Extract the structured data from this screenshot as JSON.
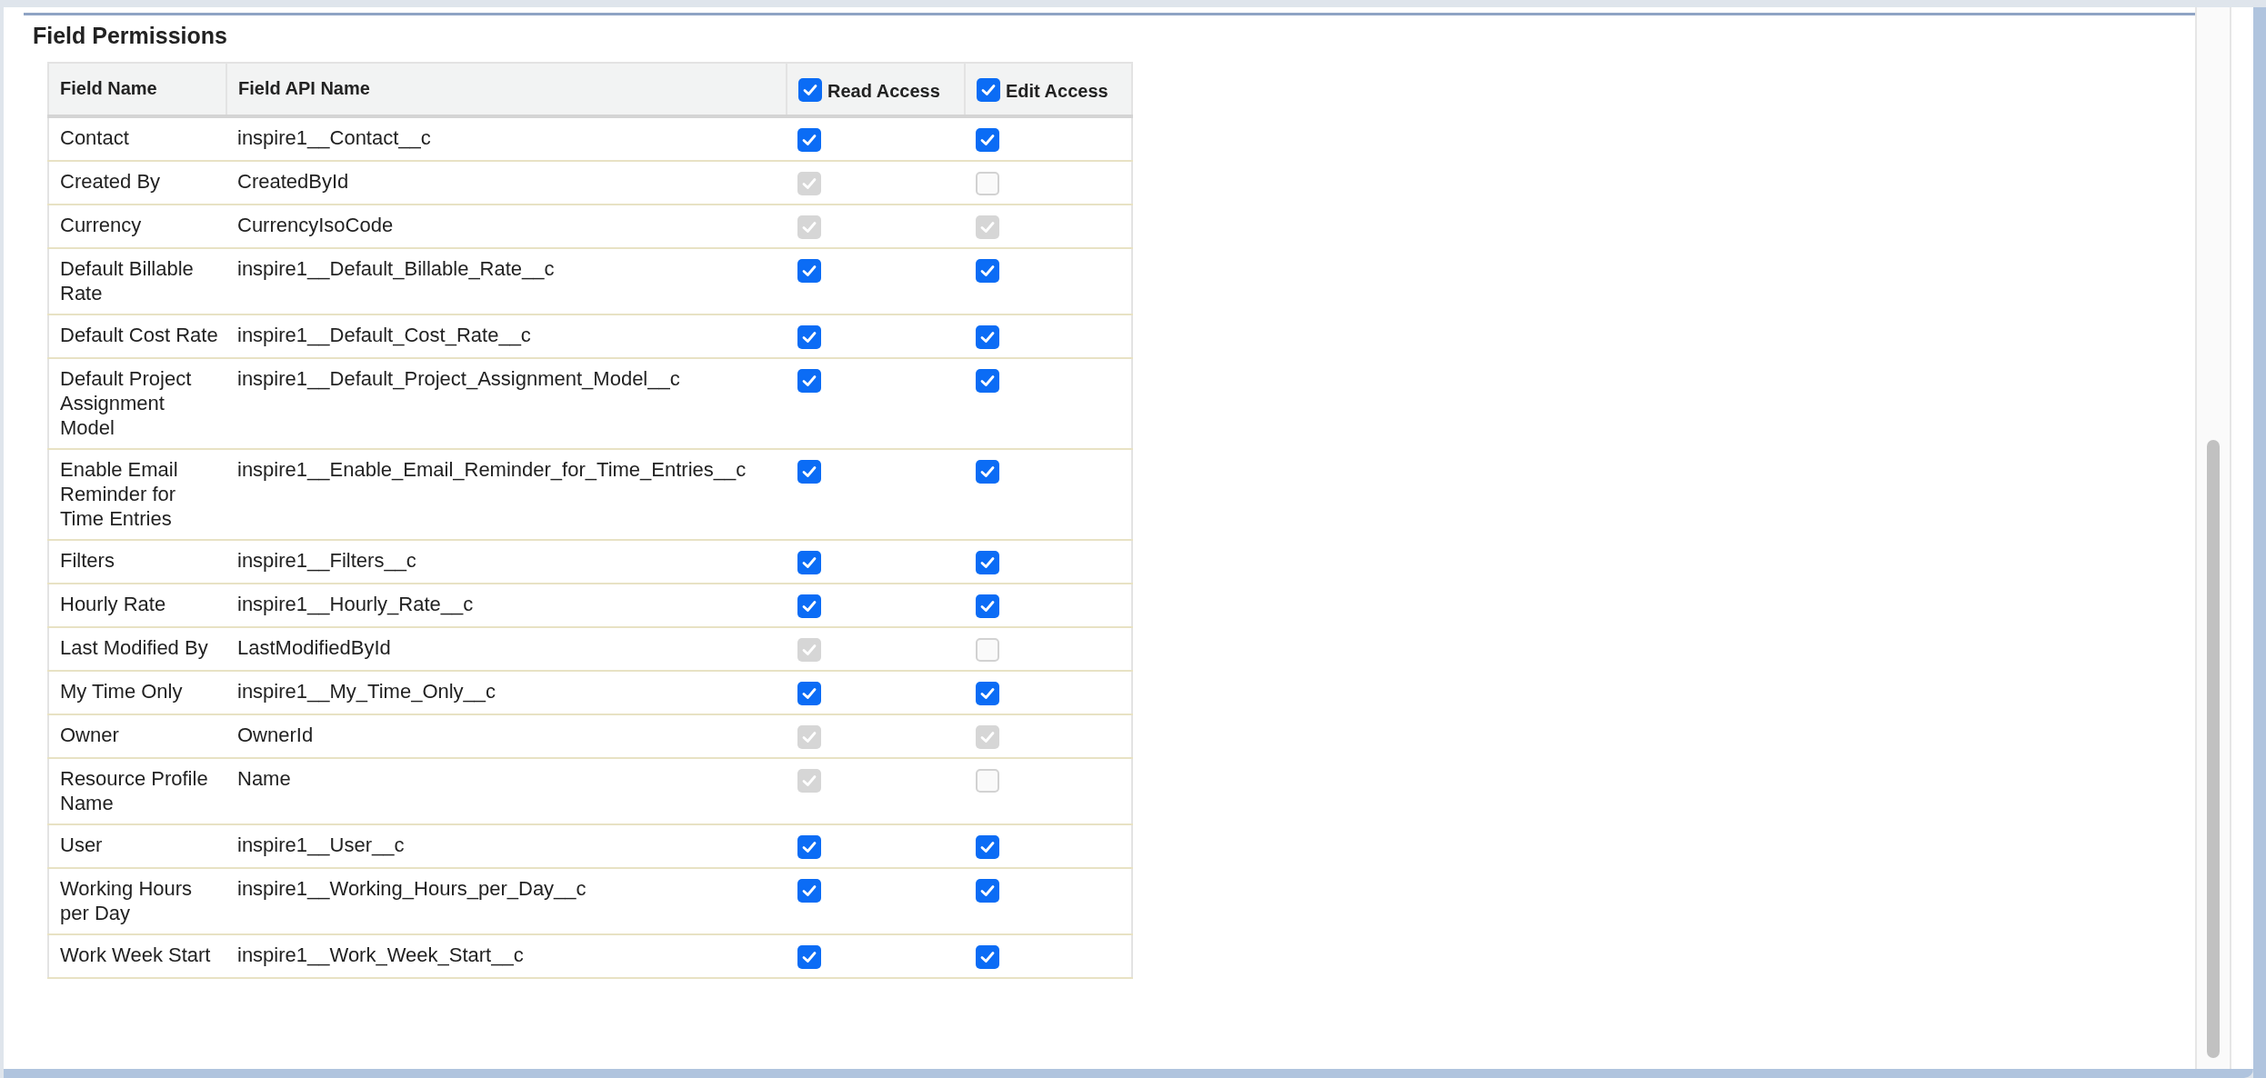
{
  "section": {
    "title": "Field Permissions"
  },
  "table": {
    "columns": [
      {
        "label": "Field Name"
      },
      {
        "label": "Field API Name"
      },
      {
        "label": "Read Access",
        "checked": true,
        "disabled": false
      },
      {
        "label": "Edit Access",
        "checked": true,
        "disabled": false
      }
    ],
    "rows": [
      {
        "field_name": "Contact",
        "api_name": "inspire1__Contact__c",
        "read": {
          "checked": true,
          "disabled": false
        },
        "edit": {
          "checked": true,
          "disabled": false
        }
      },
      {
        "field_name": "Created By",
        "api_name": "CreatedById",
        "read": {
          "checked": true,
          "disabled": true
        },
        "edit": {
          "checked": false,
          "disabled": true
        }
      },
      {
        "field_name": "Currency",
        "api_name": "CurrencyIsoCode",
        "read": {
          "checked": true,
          "disabled": true
        },
        "edit": {
          "checked": true,
          "disabled": true
        }
      },
      {
        "field_name": "Default Billable Rate",
        "api_name": "inspire1__Default_Billable_Rate__c",
        "read": {
          "checked": true,
          "disabled": false
        },
        "edit": {
          "checked": true,
          "disabled": false
        }
      },
      {
        "field_name": "Default Cost Rate",
        "api_name": "inspire1__Default_Cost_Rate__c",
        "read": {
          "checked": true,
          "disabled": false
        },
        "edit": {
          "checked": true,
          "disabled": false
        }
      },
      {
        "field_name": "Default Project Assignment Model",
        "api_name": "inspire1__Default_Project_Assignment_Model__c",
        "read": {
          "checked": true,
          "disabled": false
        },
        "edit": {
          "checked": true,
          "disabled": false
        }
      },
      {
        "field_name": "Enable Email Reminder for Time Entries",
        "api_name": "inspire1__Enable_Email_Reminder_for_Time_Entries__c",
        "read": {
          "checked": true,
          "disabled": false
        },
        "edit": {
          "checked": true,
          "disabled": false
        }
      },
      {
        "field_name": "Filters",
        "api_name": "inspire1__Filters__c",
        "read": {
          "checked": true,
          "disabled": false
        },
        "edit": {
          "checked": true,
          "disabled": false
        }
      },
      {
        "field_name": "Hourly Rate",
        "api_name": "inspire1__Hourly_Rate__c",
        "read": {
          "checked": true,
          "disabled": false
        },
        "edit": {
          "checked": true,
          "disabled": false
        }
      },
      {
        "field_name": "Last Modified By",
        "api_name": "LastModifiedById",
        "read": {
          "checked": true,
          "disabled": true
        },
        "edit": {
          "checked": false,
          "disabled": true
        }
      },
      {
        "field_name": "My Time Only",
        "api_name": "inspire1__My_Time_Only__c",
        "read": {
          "checked": true,
          "disabled": false
        },
        "edit": {
          "checked": true,
          "disabled": false
        }
      },
      {
        "field_name": "Owner",
        "api_name": "OwnerId",
        "read": {
          "checked": true,
          "disabled": true
        },
        "edit": {
          "checked": true,
          "disabled": true
        }
      },
      {
        "field_name": "Resource Profile Name",
        "api_name": "Name",
        "read": {
          "checked": true,
          "disabled": true
        },
        "edit": {
          "checked": false,
          "disabled": true
        }
      },
      {
        "field_name": "User",
        "api_name": "inspire1__User__c",
        "read": {
          "checked": true,
          "disabled": false
        },
        "edit": {
          "checked": true,
          "disabled": false
        }
      },
      {
        "field_name": "Working Hours per Day",
        "api_name": "inspire1__Working_Hours_per_Day__c",
        "read": {
          "checked": true,
          "disabled": false
        },
        "edit": {
          "checked": true,
          "disabled": false
        }
      },
      {
        "field_name": "Work Week Start",
        "api_name": "inspire1__Work_Week_Start__c",
        "read": {
          "checked": true,
          "disabled": false
        },
        "edit": {
          "checked": true,
          "disabled": false
        }
      }
    ]
  }
}
